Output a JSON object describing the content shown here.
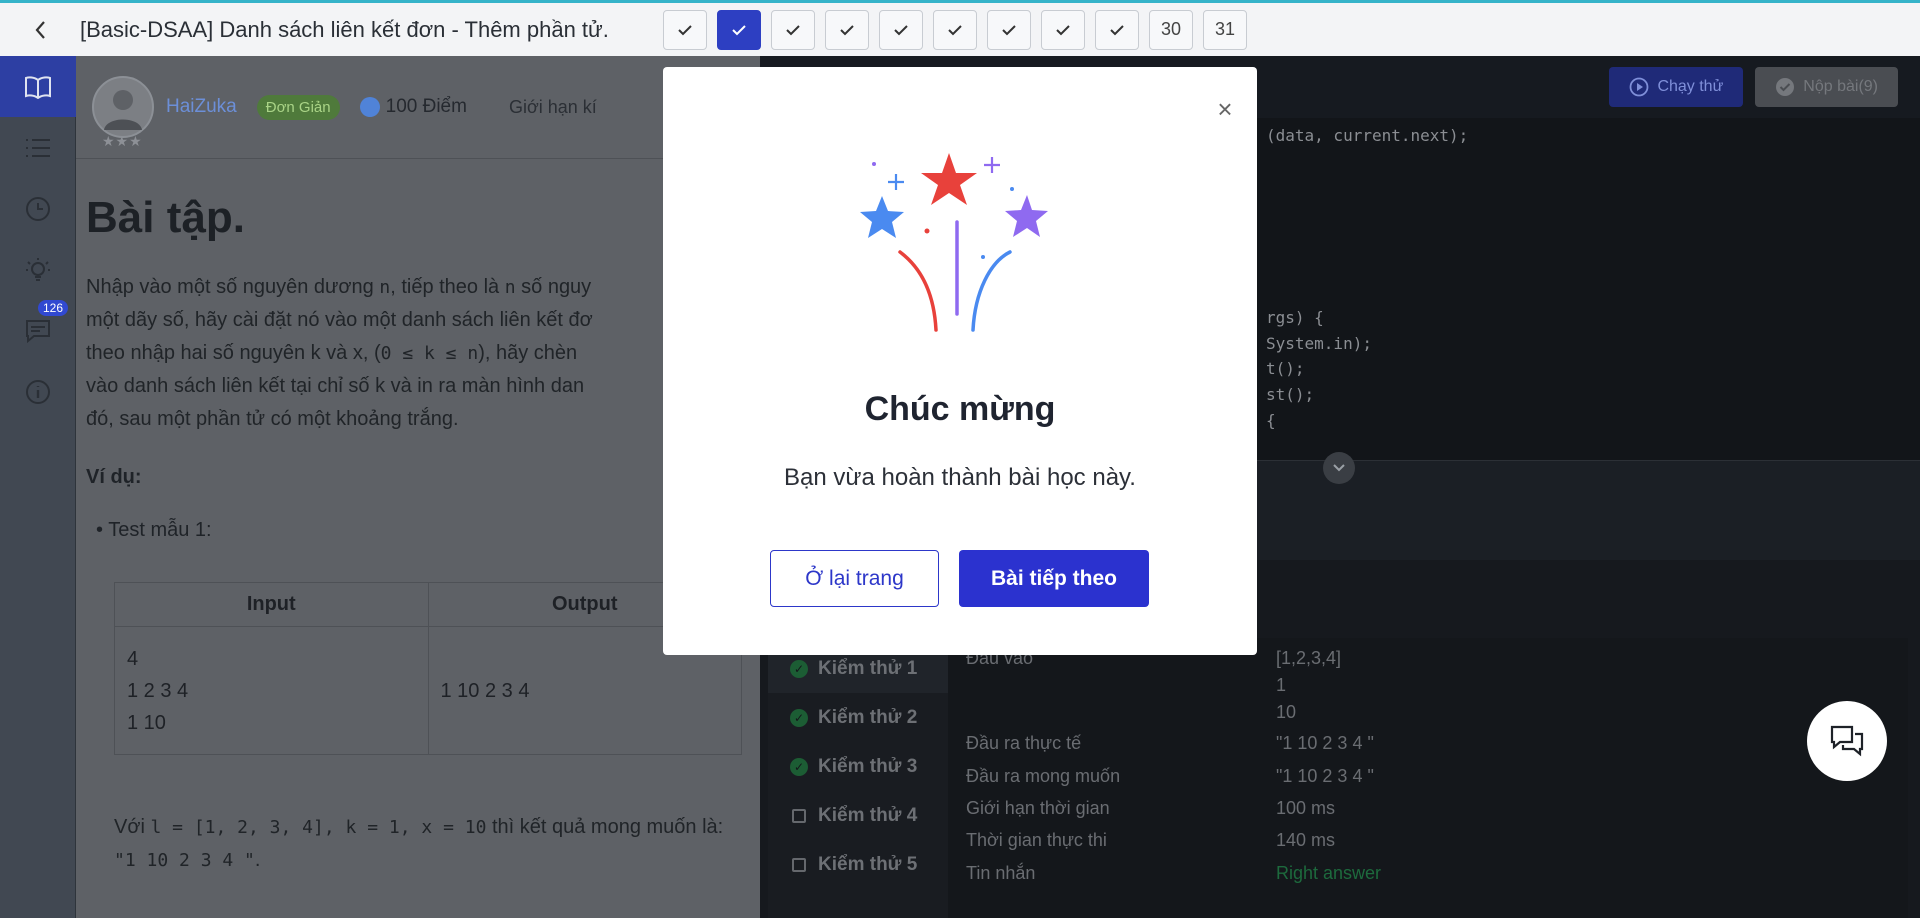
{
  "header": {
    "title": "[Basic-DSAA] Danh sách liên kết đơn - Thêm phần tử.",
    "steps": [
      {
        "label": "",
        "state": "done"
      },
      {
        "label": "",
        "state": "current"
      },
      {
        "label": "",
        "state": "done"
      },
      {
        "label": "",
        "state": "done"
      },
      {
        "label": "",
        "state": "done"
      },
      {
        "label": "",
        "state": "done"
      },
      {
        "label": "",
        "state": "done"
      },
      {
        "label": "",
        "state": "done"
      },
      {
        "label": "",
        "state": "done"
      },
      {
        "label": "30",
        "state": "todo"
      },
      {
        "label": "31",
        "state": "todo"
      }
    ]
  },
  "rail": {
    "items": [
      "book-icon",
      "list-icon",
      "clock-icon",
      "bulb-icon",
      "comment-icon",
      "info-icon"
    ],
    "comment_badge": "126"
  },
  "user": {
    "name": "HaiZuka",
    "level": "Đơn Giản",
    "points": "100 Điểm",
    "limit_label": "Giới hạn kí"
  },
  "problem": {
    "heading": "Bài tập.",
    "paragraph": {
      "p1": "Nhập vào một số nguyên dương ",
      "c1": "n",
      "p2": ", tiếp theo là ",
      "c2": "n",
      "p3": " số nguy",
      "line2": "một dãy số, hãy cài đặt nó vào một danh sách liên kết đơ",
      "line3a": "theo nhập hai số nguyên k và x, (",
      "c3": "0 ≤ k ≤ n",
      "line3b": "), hãy chèn",
      "line4": "vào danh sách liên kết tại chỉ số k và in ra màn hình dan",
      "line5": "đó, sau một phần tử có một khoảng trắng."
    },
    "example_label": "Ví dụ:",
    "bullet": "Test mẫu 1:",
    "sample": {
      "headers": [
        "Input",
        "Output"
      ],
      "input_lines": [
        "4",
        "1 2 3 4",
        "1 10"
      ],
      "output": "1 10 2 3 4"
    },
    "note": {
      "t1": "Với ",
      "c1": "l = [1, 2, 3, 4], k = 1, x = 10",
      "t2": " thì kết quả mong muốn là:",
      "c2": "\"1 10 2 3 4 \"",
      "t3": "."
    }
  },
  "editor": {
    "run_label": "Chạy thử",
    "submit_label": "Nộp bài(9)",
    "lines": [
      "(data, current.next);",
      "rgs) {",
      "System.in);",
      "t();",
      "st();",
      "{"
    ]
  },
  "tests": {
    "items": [
      {
        "label": "Kiểm thử 1",
        "status": "passed"
      },
      {
        "label": "Kiểm thử 2",
        "status": "passed"
      },
      {
        "label": "Kiểm thử 3",
        "status": "passed"
      },
      {
        "label": "Kiểm thử 4",
        "status": "locked"
      },
      {
        "label": "Kiểm thử 5",
        "status": "locked"
      }
    ],
    "detail": {
      "input_label": "Đầu vào",
      "input_lines": [
        "[1,2,3,4]",
        "1",
        "10"
      ],
      "actual_label": "Đầu ra thực tế",
      "actual": "\"1 10 2 3 4 \"",
      "expected_label": "Đầu ra mong muốn",
      "expected": "\"1 10 2 3 4 \"",
      "time_limit_label": "Giới hạn thời gian",
      "time_limit": "100 ms",
      "exec_time_label": "Thời gian thực thi",
      "exec_time": "140 ms",
      "message_label": "Tin nhắn",
      "message": "Right answer"
    }
  },
  "modal": {
    "title": "Chúc mừng",
    "message": "Bạn vừa hoàn thành bài học này.",
    "stay_label": "Ở lại trang",
    "next_label": "Bài tiếp theo"
  },
  "colors": {
    "accent": "#2b32cf",
    "star_red": "#e8413b",
    "star_blue": "#4a8af0",
    "star_purple": "#8f6af0",
    "success": "#1c5d34"
  }
}
